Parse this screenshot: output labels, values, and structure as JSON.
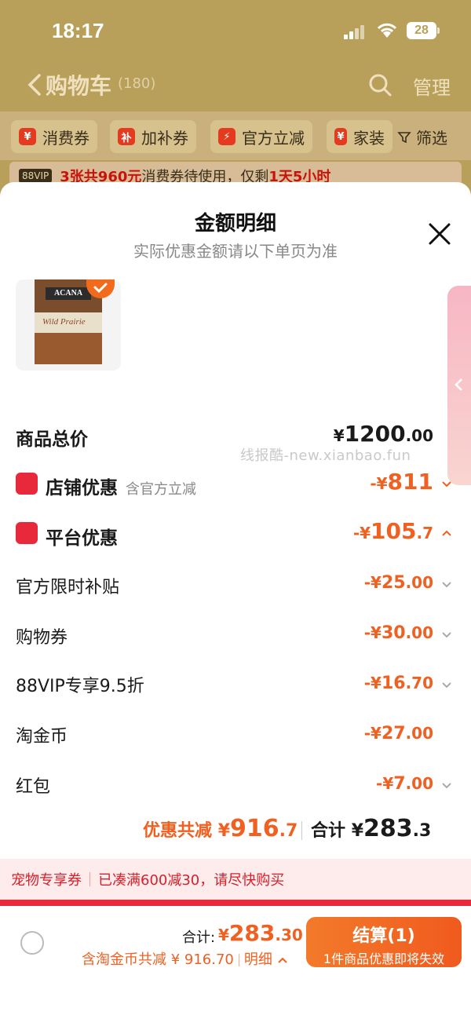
{
  "status_bar": {
    "time": "18:17",
    "battery": "28"
  },
  "nav": {
    "title": "购物车",
    "count": "(180)",
    "manage": "管理"
  },
  "filters": [
    {
      "icon": "¥",
      "label": "消费券"
    },
    {
      "icon": "补",
      "label": "加补券"
    },
    {
      "icon": "⚡",
      "label": "官方立减"
    },
    {
      "icon": "¥",
      "label": "家装"
    }
  ],
  "filter_button": "筛选",
  "vip_banner": {
    "tag": "88VIP",
    "part1": "3张共960元",
    "part2": "消费券待使用，仅剩",
    "part3": "1天5小时"
  },
  "sheet": {
    "title": "金额明细",
    "subtitle": "实际优惠金额请以下单页为准"
  },
  "product": {
    "brand": "ACANA",
    "name": "Wild Prairie"
  },
  "watermark": "线报酷-new.xianbao.fun",
  "price_rows": {
    "total": {
      "label": "商品总价",
      "y": "¥",
      "int": "1200",
      "dec": ".00"
    },
    "shop": {
      "label": "店铺优惠",
      "note": "含官方立减",
      "y": "-¥",
      "int": "811",
      "dec": ""
    },
    "platform": {
      "label": "平台优惠",
      "y": "-¥",
      "int": "105",
      "dec": ".7"
    },
    "items": [
      {
        "label": "官方限时补贴",
        "y": "-¥",
        "int": "25",
        "dec": ".00"
      },
      {
        "label": "购物券",
        "y": "-¥",
        "int": "30",
        "dec": ".00"
      },
      {
        "label": "88VIP专享9.5折",
        "y": "-¥",
        "int": "16",
        "dec": ".70"
      },
      {
        "label": "淘金币",
        "y": "-¥",
        "int": "27",
        "dec": ".00"
      },
      {
        "label": "红包",
        "y": "-¥",
        "int": "7",
        "dec": ".00"
      }
    ]
  },
  "summary": {
    "discount_label": "优惠共减",
    "discount_y": "¥",
    "discount_int": "916",
    "discount_dec": ".7",
    "total_label": "合计",
    "total_y": "¥",
    "total_int": "283",
    "total_dec": ".3"
  },
  "pet_banner": {
    "tag": "宠物专享券",
    "text": "已凑满600减30，请尽快购买"
  },
  "bottom": {
    "total_label": "合计:",
    "y": "¥",
    "int": "283",
    "dec": ".30",
    "coin_note": "含淘金币共减 ¥ 916.70",
    "detail": "明细",
    "checkout": "结算(1)",
    "checkout_sub": "1件商品优惠即将失效"
  },
  "colors": {
    "accent": "#f06020",
    "red": "#e8293b",
    "overlay": "#b9a05a"
  }
}
